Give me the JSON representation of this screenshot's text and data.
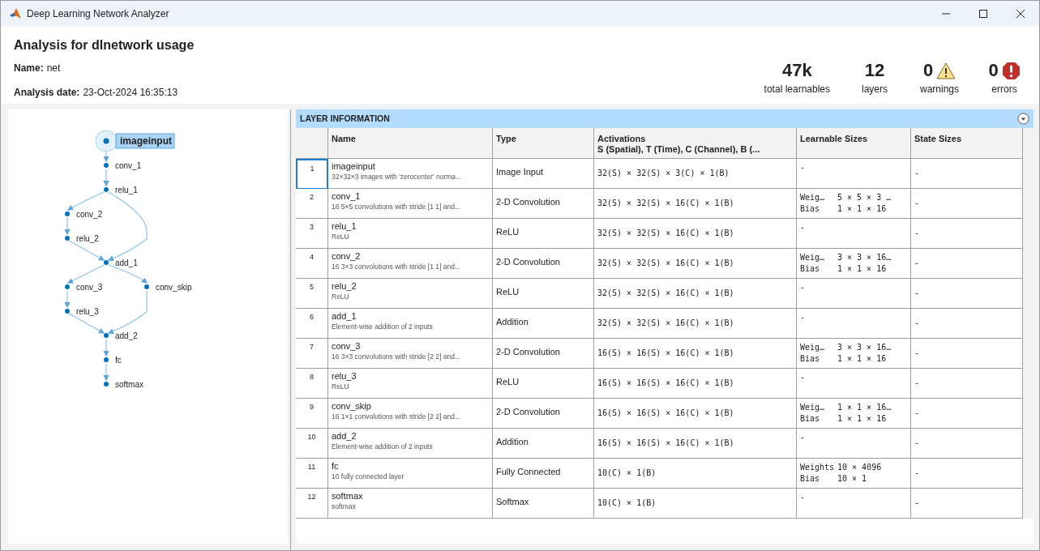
{
  "window": {
    "title": "Deep Learning Network Analyzer"
  },
  "header": {
    "title": "Analysis for dlnetwork usage",
    "name_label": "Name:",
    "name_value": "net",
    "date_label": "Analysis date:",
    "date_value": "23-Oct-2024 16:35:13"
  },
  "stats": [
    {
      "kind": "plain",
      "value": "47k",
      "label": "total learnables"
    },
    {
      "kind": "plain",
      "value": "12",
      "label": "layers"
    },
    {
      "kind": "warning",
      "value": "0",
      "label": "warnings"
    },
    {
      "kind": "error",
      "value": "0",
      "label": "errors"
    }
  ],
  "graph": {
    "nodes": [
      {
        "label": "imageinput",
        "selected": true
      },
      {
        "label": "conv_1",
        "selected": false
      },
      {
        "label": "relu_1",
        "selected": false
      },
      {
        "label": "conv_2",
        "selected": false
      },
      {
        "label": "relu_2",
        "selected": false
      },
      {
        "label": "add_1",
        "selected": false
      },
      {
        "label": "conv_3",
        "selected": false
      },
      {
        "label": "relu_3",
        "selected": false
      },
      {
        "label": "conv_skip",
        "selected": false
      },
      {
        "label": "add_2",
        "selected": false
      },
      {
        "label": "fc",
        "selected": false
      },
      {
        "label": "softmax",
        "selected": false
      }
    ]
  },
  "table": {
    "title": "LAYER INFORMATION",
    "columns": [
      "Name",
      "Type",
      "Activations",
      "Learnable Sizes",
      "State Sizes"
    ],
    "activations_subtitle": "S (Spatial), T (Time), C (Channel), B (...",
    "rows": [
      {
        "index": "1",
        "selected": true,
        "name": "imageinput",
        "description": "32×32×3 images with 'zerocenter' norma...",
        "type": "Image Input",
        "activations": "32(S) × 32(S) × 3(C) × 1(B)",
        "learnables": [],
        "learnables_empty": "-",
        "state": "-"
      },
      {
        "index": "2",
        "selected": false,
        "name": "conv_1",
        "description": "16 5×5 convolutions with stride [1 1] and...",
        "type": "2-D Convolution",
        "activations": "32(S) × 32(S) × 16(C) × 1(B)",
        "learnables": [
          {
            "name": "Weig…",
            "value": "5 × 5 × 3 …"
          },
          {
            "name": "Bias",
            "value": "1 × 1 × 16"
          }
        ],
        "state": "-"
      },
      {
        "index": "3",
        "selected": false,
        "name": "relu_1",
        "description": "ReLU",
        "type": "ReLU",
        "activations": "32(S) × 32(S) × 16(C) × 1(B)",
        "learnables": [],
        "learnables_empty": "-",
        "state": "-"
      },
      {
        "index": "4",
        "selected": false,
        "name": "conv_2",
        "description": "16 3×3 convolutions with stride [1 1] and...",
        "type": "2-D Convolution",
        "activations": "32(S) × 32(S) × 16(C) × 1(B)",
        "learnables": [
          {
            "name": "Weig…",
            "value": "3 × 3 × 16…"
          },
          {
            "name": "Bias",
            "value": "1 × 1 × 16"
          }
        ],
        "state": "-"
      },
      {
        "index": "5",
        "selected": false,
        "name": "relu_2",
        "description": "ReLU",
        "type": "ReLU",
        "activations": "32(S) × 32(S) × 16(C) × 1(B)",
        "learnables": [],
        "learnables_empty": "-",
        "state": "-"
      },
      {
        "index": "6",
        "selected": false,
        "name": "add_1",
        "description": "Element-wise addition of 2 inputs",
        "type": "Addition",
        "activations": "32(S) × 32(S) × 16(C) × 1(B)",
        "learnables": [],
        "learnables_empty": "-",
        "state": "-"
      },
      {
        "index": "7",
        "selected": false,
        "name": "conv_3",
        "description": "16 3×3 convolutions with stride [2 2] and...",
        "type": "2-D Convolution",
        "activations": "16(S) × 16(S) × 16(C) × 1(B)",
        "learnables": [
          {
            "name": "Weig…",
            "value": "3 × 3 × 16…"
          },
          {
            "name": "Bias",
            "value": "1 × 1 × 16"
          }
        ],
        "state": "-"
      },
      {
        "index": "8",
        "selected": false,
        "name": "relu_3",
        "description": "ReLU",
        "type": "ReLU",
        "activations": "16(S) × 16(S) × 16(C) × 1(B)",
        "learnables": [],
        "learnables_empty": "-",
        "state": "-"
      },
      {
        "index": "9",
        "selected": false,
        "name": "conv_skip",
        "description": "16 1×1 convolutions with stride [2 2] and...",
        "type": "2-D Convolution",
        "activations": "16(S) × 16(S) × 16(C) × 1(B)",
        "learnables": [
          {
            "name": "Weig…",
            "value": "1 × 1 × 16…"
          },
          {
            "name": "Bias",
            "value": "1 × 1 × 16"
          }
        ],
        "state": "-"
      },
      {
        "index": "10",
        "selected": false,
        "name": "add_2",
        "description": "Element-wise addition of 2 inputs",
        "type": "Addition",
        "activations": "16(S) × 16(S) × 16(C) × 1(B)",
        "learnables": [],
        "learnables_empty": "-",
        "state": "-"
      },
      {
        "index": "11",
        "selected": false,
        "name": "fc",
        "description": "10 fully connected layer",
        "type": "Fully Connected",
        "activations": "10(C) × 1(B)",
        "learnables": [
          {
            "name": "Weights",
            "value": "10 × 4096"
          },
          {
            "name": "Bias",
            "value": "10 × 1"
          }
        ],
        "state": "-"
      },
      {
        "index": "12",
        "selected": false,
        "name": "softmax",
        "description": "softmax",
        "type": "Softmax",
        "activations": "10(C) × 1(B)",
        "learnables": [],
        "learnables_empty": "-",
        "state": "-"
      }
    ]
  }
}
